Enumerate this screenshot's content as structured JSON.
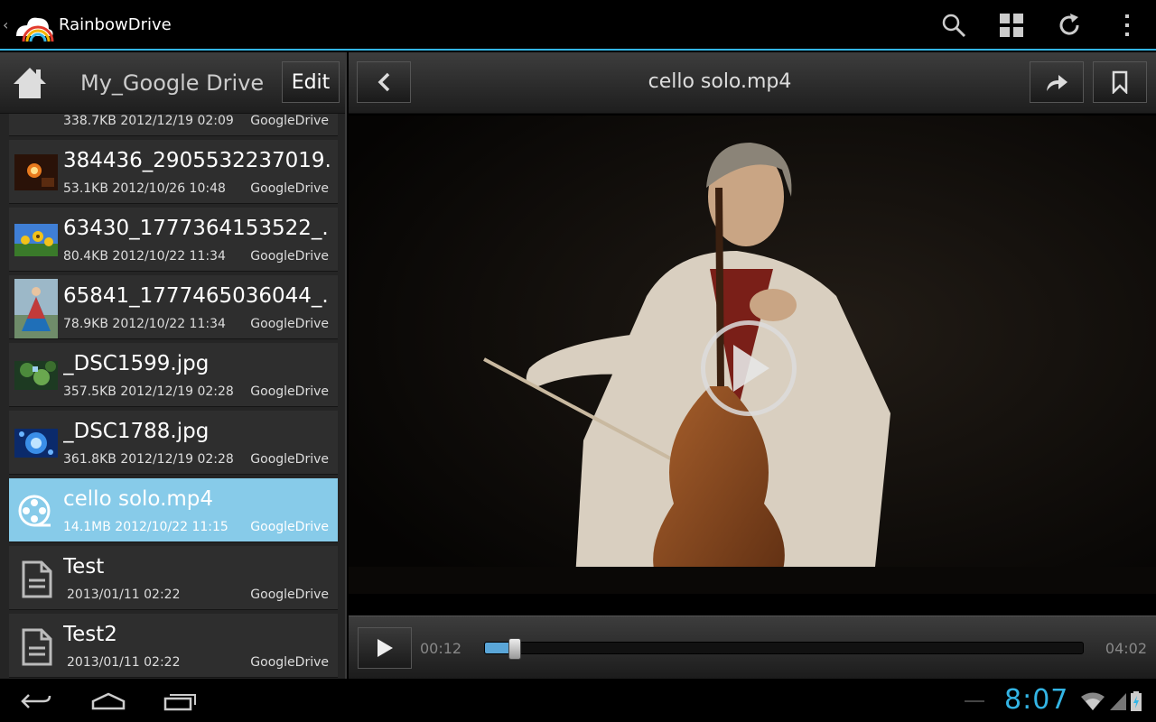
{
  "app": {
    "title": "RainbowDrive",
    "icons": [
      "search-icon",
      "grid-view-icon",
      "refresh-icon",
      "overflow-menu-icon"
    ]
  },
  "left_panel": {
    "title": "My_Google Drive",
    "edit_label": "Edit",
    "files": [
      {
        "name": "",
        "meta": "338.7KB 2012/12/19 02:09",
        "source": "GoogleDrive",
        "thumb": "partial"
      },
      {
        "name": "384436_2905532237019.",
        "meta": "53.1KB 2012/10/26 10:48",
        "source": "GoogleDrive",
        "thumb": "photo-fire"
      },
      {
        "name": "63430_1777364153522_.",
        "meta": "80.4KB 2012/10/22 11:34",
        "source": "GoogleDrive",
        "thumb": "photo-sunflower"
      },
      {
        "name": "65841_1777465036044_.",
        "meta": "78.9KB 2012/10/22 11:34",
        "source": "GoogleDrive",
        "thumb": "photo-dancer"
      },
      {
        "name": "_DSC1599.jpg",
        "meta": "357.5KB 2012/12/19 02:28",
        "source": "GoogleDrive",
        "thumb": "photo-leaves"
      },
      {
        "name": "_DSC1788.jpg",
        "meta": "361.8KB 2012/12/19 02:28",
        "source": "GoogleDrive",
        "thumb": "photo-blue"
      },
      {
        "name": "cello solo.mp4",
        "meta": "14.1MB 2012/10/22 11:15",
        "source": "GoogleDrive",
        "thumb": "video-file-icon",
        "selected": true
      },
      {
        "name": "Test",
        "meta": "2013/01/11 02:22",
        "source": "GoogleDrive",
        "thumb": "document-icon"
      },
      {
        "name": "Test2",
        "meta": "2013/01/11 02:22",
        "source": "GoogleDrive",
        "thumb": "document-icon"
      }
    ]
  },
  "viewer": {
    "title": "cello solo.mp4",
    "current_time": "00:12",
    "total_time": "04:02",
    "progress": 0.05
  },
  "status_bar": {
    "time": "8:07"
  },
  "colors": {
    "accent": "#33b5e5",
    "selected_row": "#87cbe9"
  }
}
